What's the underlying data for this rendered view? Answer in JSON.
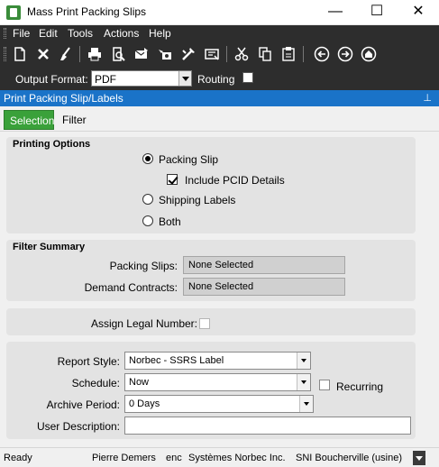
{
  "window": {
    "title": "Mass Print Packing Slips",
    "minimize": "—",
    "maximize": "☐",
    "close": "✕"
  },
  "menu": [
    "File",
    "Edit",
    "Tools",
    "Actions",
    "Help"
  ],
  "toolbar": {
    "icons": [
      "new-icon",
      "delete-icon",
      "clear-icon",
      "print-icon",
      "print-preview-icon",
      "email-icon",
      "fax-icon",
      "print-setup-icon",
      "report-icon",
      "cut-icon",
      "copy-icon",
      "paste-icon",
      "back-icon",
      "forward-icon",
      "home-icon"
    ]
  },
  "format_bar": {
    "output_label": "Output Format:",
    "output_value": "PDF",
    "routing_label": "Routing",
    "routing_checked": false
  },
  "panel": {
    "title": "Print Packing Slip/Labels",
    "pin": "⊥"
  },
  "tabs": [
    {
      "label": "Selection",
      "active": true
    },
    {
      "label": "Filter",
      "active": false
    }
  ],
  "printing_options": {
    "title": "Printing Options",
    "packing_slip": "Packing Slip",
    "packing_slip_selected": true,
    "include_pcid": "Include PCID Details",
    "include_pcid_checked": true,
    "shipping_labels": "Shipping Labels",
    "both": "Both"
  },
  "filter_summary": {
    "title": "Filter Summary",
    "packing_slips_label": "Packing Slips:",
    "packing_slips_value": "None Selected",
    "demand_contracts_label": "Demand Contracts:",
    "demand_contracts_value": "None Selected"
  },
  "legal": {
    "label": "Assign Legal Number:",
    "checked": false
  },
  "report": {
    "report_style_label": "Report Style:",
    "report_style_value": "Norbec - SSRS Label",
    "schedule_label": "Schedule:",
    "schedule_value": "Now",
    "recurring_label": "Recurring",
    "archive_label": "Archive Period:",
    "archive_value": "0 Days",
    "description_label": "User Description:",
    "description_value": ""
  },
  "status": {
    "state": "Ready",
    "user": "Pierre Demers",
    "lang": "enc",
    "company": "Systèmes Norbec Inc.",
    "site": "SNI Boucherville (usine)"
  },
  "colors": {
    "accent_green": "#3aa13a",
    "header_blue": "#1a73c8",
    "toolbar_dark": "#2d2d2d"
  }
}
